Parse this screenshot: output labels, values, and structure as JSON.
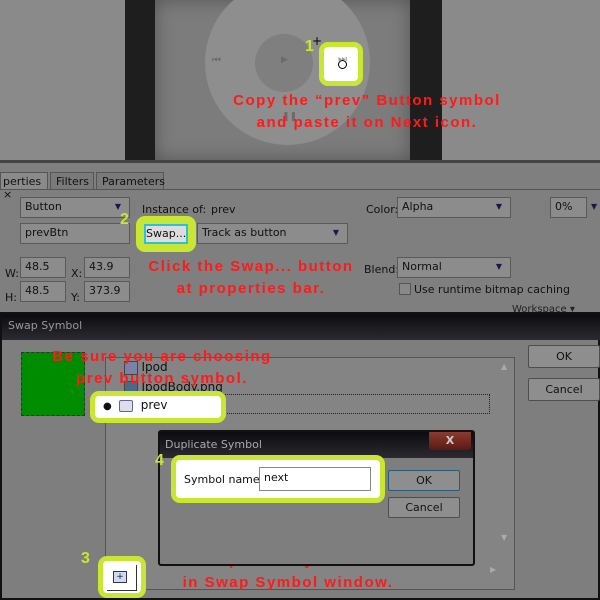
{
  "stage": {
    "step1": "1",
    "note1_line1": "Copy the  “prev”  Button symbol",
    "note1_line2": "and paste it on Next icon."
  },
  "properties": {
    "tabs": [
      "perties",
      "Filters",
      "Parameters"
    ],
    "type": "Button",
    "instance_name": "prevBtn",
    "instance_of_label": "Instance of:",
    "instance_of": "prev",
    "swap_label": "Swap...",
    "track": "Track as button",
    "w_label": "W:",
    "w": "48.5",
    "x_label": "X:",
    "x": "43.9",
    "h_label": "H:",
    "h": "48.5",
    "y_label": "Y:",
    "y": "373.9",
    "color_label": "Color:",
    "color": "Alpha",
    "alpha": "0%",
    "blend_label": "Blend:",
    "blend": "Normal",
    "cache_label": "Use runtime bitmap caching",
    "cache_checked": false,
    "workspace": "Workspace ▾",
    "step2": "2",
    "note2_line1": "Click the Swap... button",
    "note2_line2": "at properties bar."
  },
  "swap_dialog": {
    "title": "Swap Symbol",
    "ok": "OK",
    "cancel": "Cancel",
    "items": [
      "Ipod",
      "IpodBody.png",
      "prev"
    ],
    "selected": "prev",
    "note_line1": "Be sure you are choosing",
    "note_line2": "prev button symbol.",
    "step3": "3",
    "note3_line1": "Click Duplicate Symbol Button",
    "note3_line2": "in Swap Symbol window."
  },
  "duplicate_dialog": {
    "title": "Duplicate Symbol",
    "close": "X",
    "name_label": "Symbol name:",
    "name_value": "next",
    "ok": "OK",
    "cancel": "Cancel",
    "step4": "4"
  },
  "colors": {
    "accent": "#c8e632",
    "note": "#ff1a1a",
    "preview": "#008c00"
  }
}
